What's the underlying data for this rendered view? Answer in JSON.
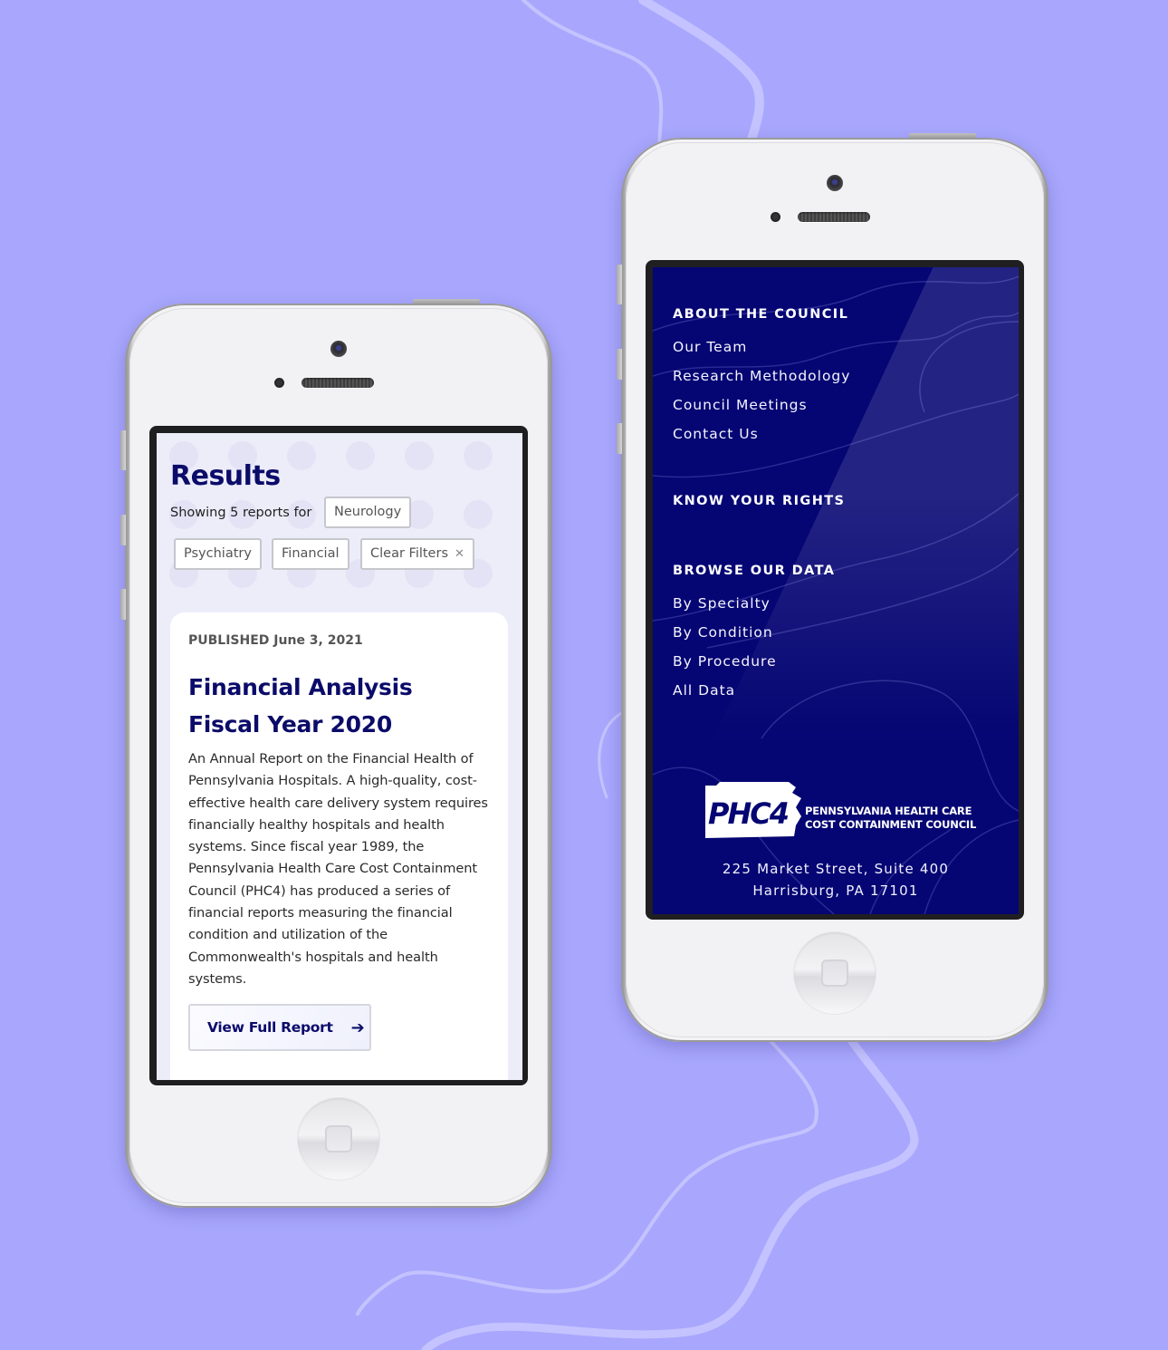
{
  "colors": {
    "background": "#a8a7fd",
    "navy": "#0b0b6a",
    "footer_bg": "#050573",
    "results_bg": "#ededfa"
  },
  "left_phone": {
    "results": {
      "title": "Results",
      "showing_text": "Showing 5 reports for",
      "filters": [
        "Neurology",
        "Psychiatry",
        "Financial"
      ],
      "clear_filters_label": "Clear Filters",
      "clear_icon": "close-icon"
    },
    "report_card": {
      "published_label": "PUBLISHED",
      "published_date": "June 3, 2021",
      "title": "Financial Analysis Fiscal Year 2020",
      "description": "An Annual Report on the Financial Health of Pennsylvania Hospitals. A high-quality, cost-effective health care delivery system requires financially healthy hospitals and health systems. Since fiscal year 1989, the Pennsylvania Health Care Cost Containment Council (PHC4) has produced a series of financial reports measuring the financial condition and utilization of the Commonwealth's hospitals and health systems.",
      "button_label": "View Full Report",
      "button_icon": "arrow-right-icon"
    }
  },
  "right_phone": {
    "sections": [
      {
        "heading": "ABOUT THE COUNCIL",
        "links": [
          "Our Team",
          "Research Methodology",
          "Council Meetings",
          "Contact Us"
        ]
      },
      {
        "heading": "KNOW YOUR RIGHTS",
        "links": []
      },
      {
        "heading": "BROWSE OUR DATA",
        "links": [
          "By Specialty",
          "By Condition",
          "By Procedure",
          "All Data"
        ]
      }
    ],
    "logo": {
      "mark": "PHC4",
      "line1": "PENNSYLVANIA HEALTH CARE",
      "line2": "COST CONTAINMENT COUNCIL"
    },
    "address": {
      "line1": "225 Market Street, Suite 400",
      "line2": "Harrisburg, PA 17101"
    }
  }
}
